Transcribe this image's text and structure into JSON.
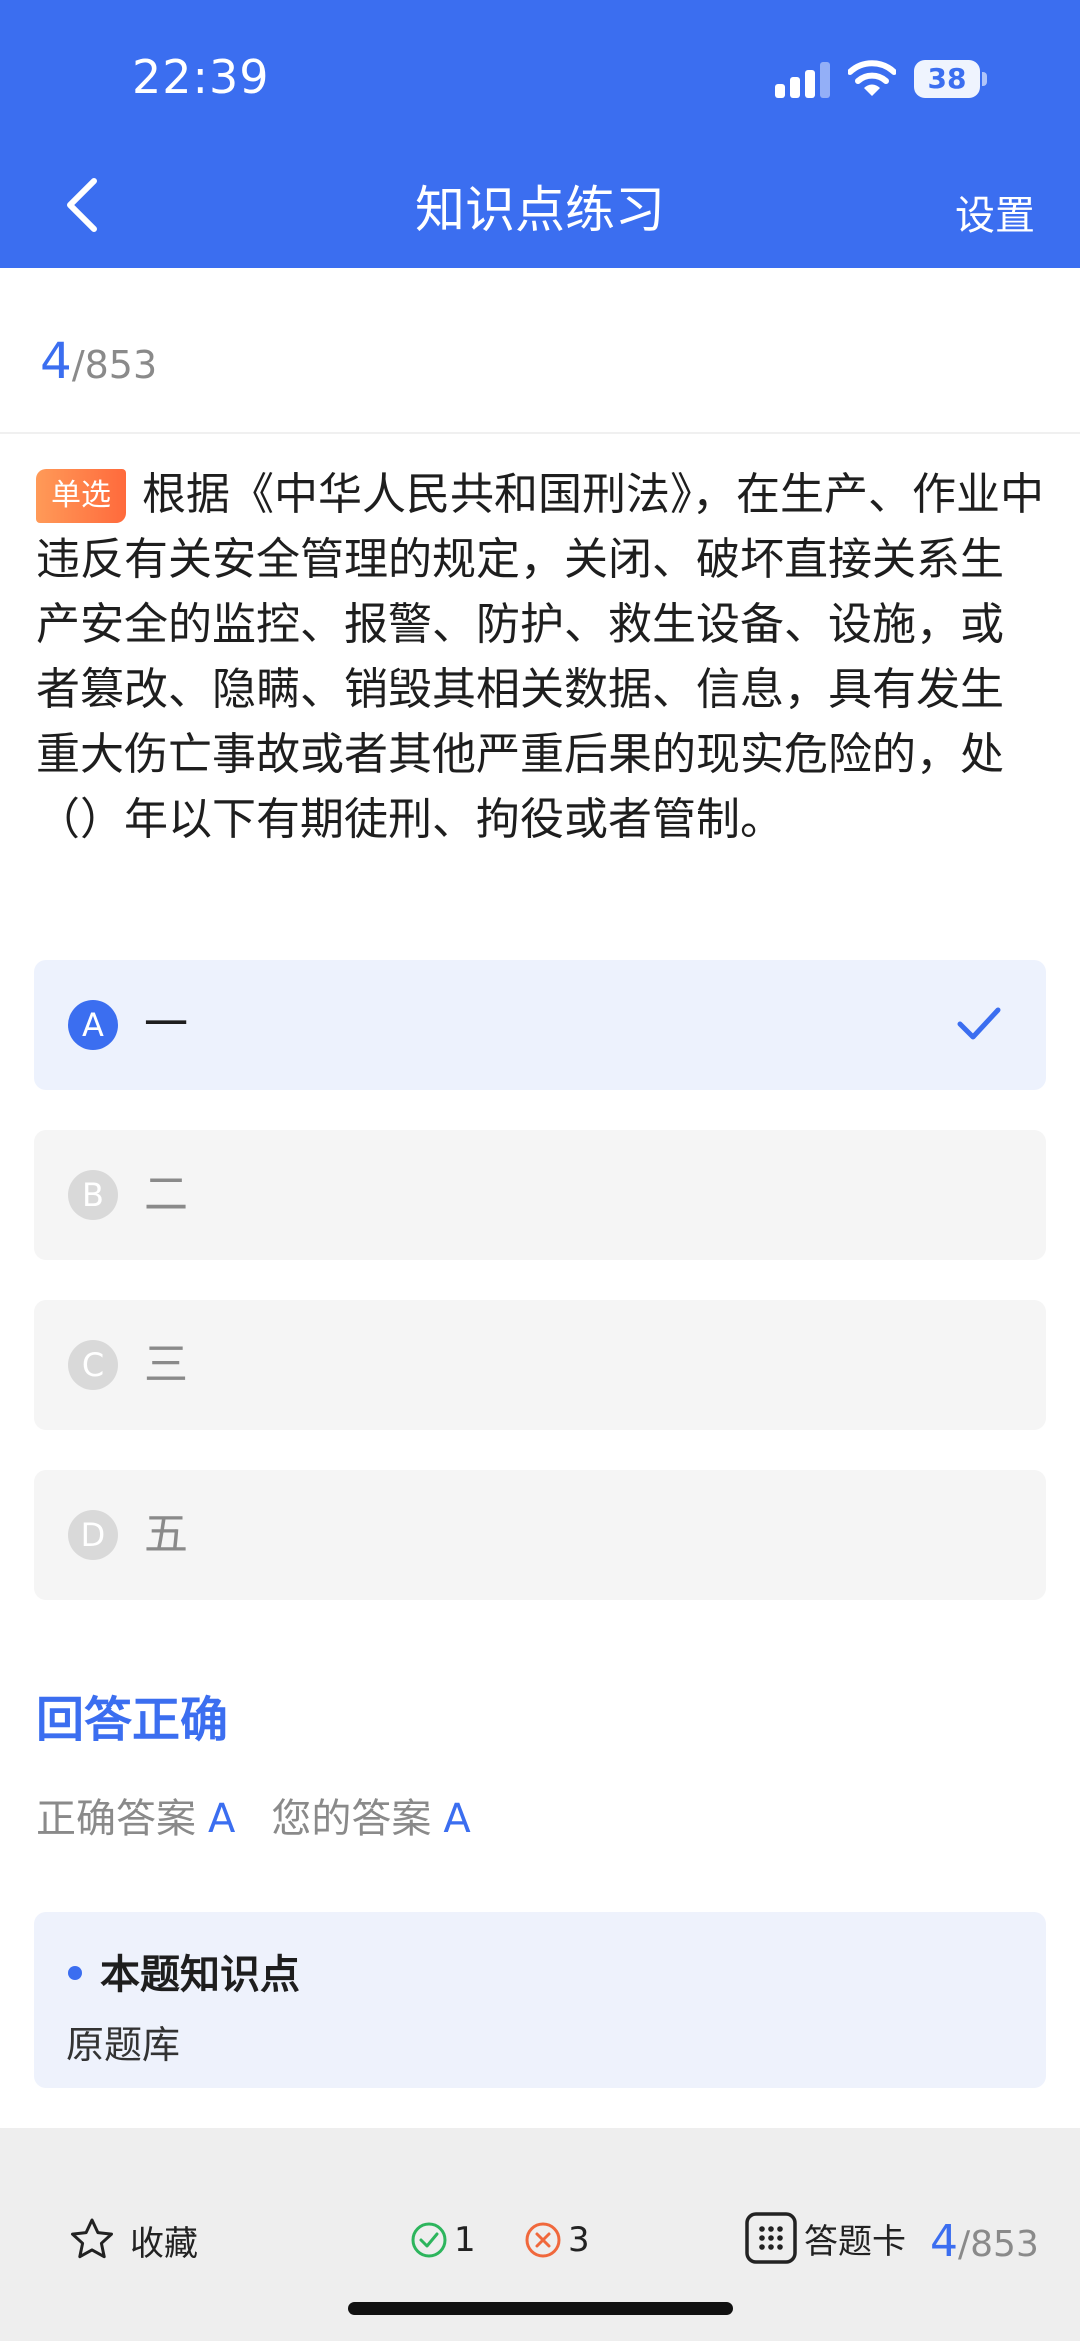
{
  "status_bar": {
    "time": "22:39",
    "battery": "38"
  },
  "nav": {
    "title": "知识点练习",
    "settings": "设置"
  },
  "progress": {
    "current": "4",
    "total": "/853"
  },
  "question": {
    "type_tag": "单选",
    "text": "根据《中华人民共和国刑法》，在生产、作业中违反有关安全管理的规定，关闭、破坏直接关系生产安全的监控、报警、防护、救生设备、设施，或者篡改、隐瞒、销毁其相关数据、信息，具有发生重大伤亡事故或者其他严重后果的现实危险的，处（）年以下有期徒刑、拘役或者管制。"
  },
  "options": [
    {
      "letter": "A",
      "text": "一",
      "selected": true
    },
    {
      "letter": "B",
      "text": "二",
      "selected": false
    },
    {
      "letter": "C",
      "text": "三",
      "selected": false
    },
    {
      "letter": "D",
      "text": "五",
      "selected": false
    }
  ],
  "result": {
    "title": "回答正确",
    "correct_label": "正确答案",
    "correct_value": "A",
    "your_label": "您的答案",
    "your_value": "A"
  },
  "knowledge": {
    "title": "本题知识点",
    "value": "原题库"
  },
  "bottom_bar": {
    "favorite": "收藏",
    "correct_count": "1",
    "wrong_count": "3",
    "answer_card": "答题卡",
    "progress_current": "4",
    "progress_total": "/853"
  },
  "colors": {
    "accent": "#3b6ef0",
    "correct": "#2db55d",
    "wrong": "#f0683c",
    "tag": "#ff7a45"
  }
}
